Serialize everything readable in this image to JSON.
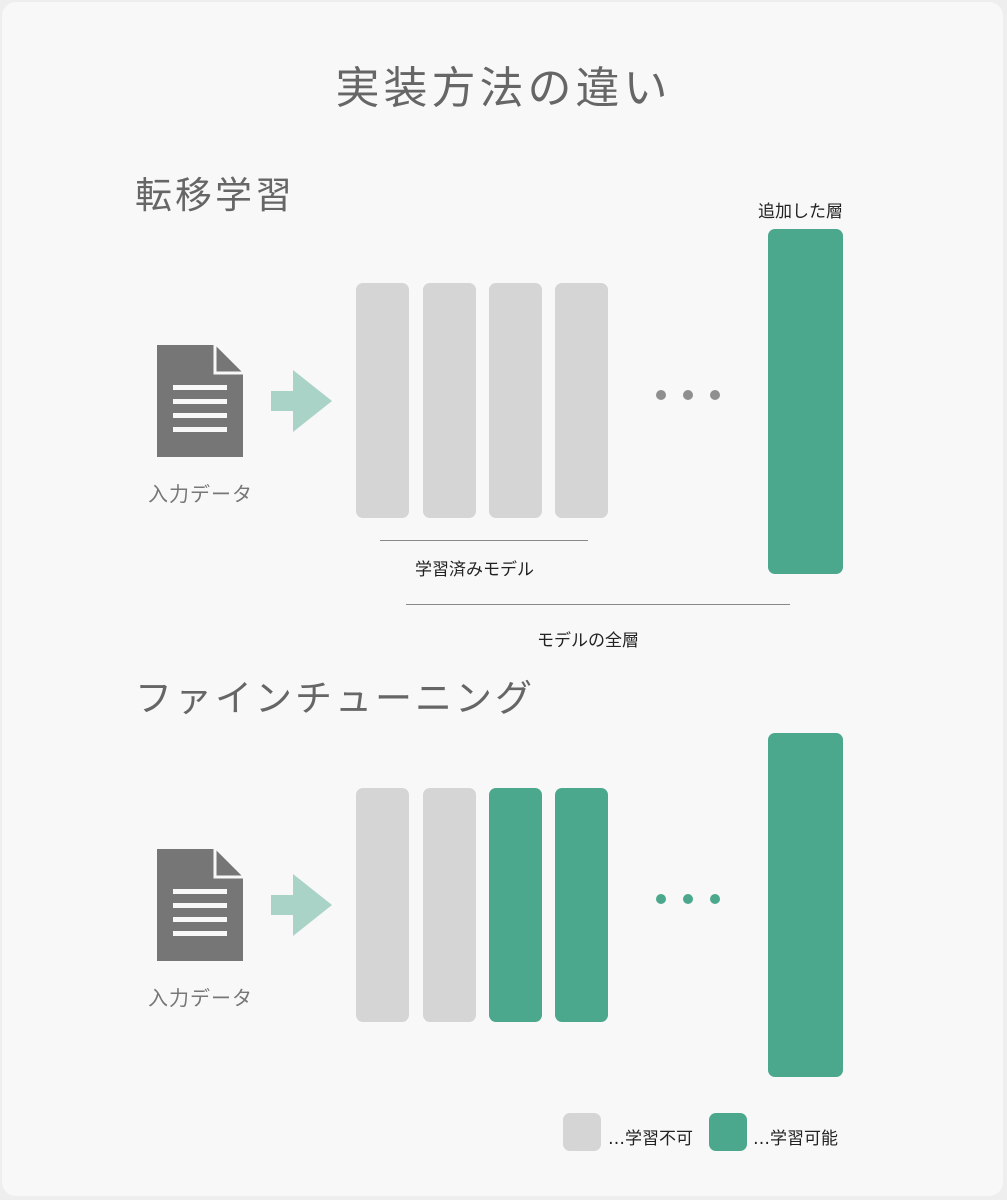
{
  "title": "実装方法の違い",
  "transfer_learning": {
    "heading": "転移学習",
    "added_layer_label": "追加した層",
    "input_label": "入力データ",
    "pretrained_label": "学習済みモデル",
    "all_layers_label": "モデルの全層"
  },
  "fine_tuning": {
    "heading": "ファインチューニング",
    "input_label": "入力データ"
  },
  "legend": {
    "not_trainable": "…学習不可",
    "trainable": "…学習可能"
  },
  "colors": {
    "frozen": "#d5d5d5",
    "trainable": "#4ba88c",
    "arrow": "#a9d3c6",
    "document": "#767676"
  },
  "icons": [
    "document-icon",
    "arrow-right-icon",
    "ellipsis-icon"
  ]
}
